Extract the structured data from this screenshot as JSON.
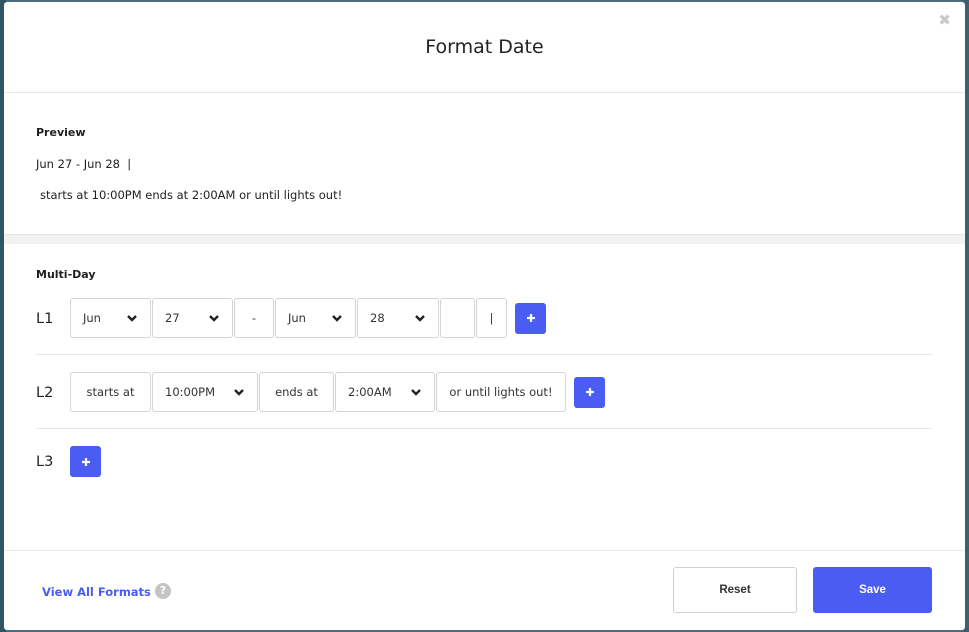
{
  "modal": {
    "title": "Format Date",
    "close_glyph": "✖"
  },
  "preview": {
    "label": "Preview",
    "line1": "Jun 27 - Jun 28  |",
    "line2": "starts at 10:00PM ends at 2:00AM or until lights out!"
  },
  "multi_day": {
    "label": "Multi-Day",
    "l1": {
      "label": "L1",
      "month_start": "Jun",
      "day_start": "27",
      "separator": "-",
      "month_end": "Jun",
      "day_end": "28",
      "empty_text": "",
      "pipe_text": "|"
    },
    "l2": {
      "label": "L2",
      "starts_text": "starts at",
      "start_time": "10:00PM",
      "ends_text": "ends at",
      "end_time": "2:00AM",
      "suffix_text": "or until lights out!"
    },
    "l3": {
      "label": "L3"
    }
  },
  "footer": {
    "view_all": "View All Formats",
    "help_glyph": "?",
    "reset_label": "Reset",
    "save_label": "Save"
  },
  "colors": {
    "accent": "#4a5cf2"
  }
}
